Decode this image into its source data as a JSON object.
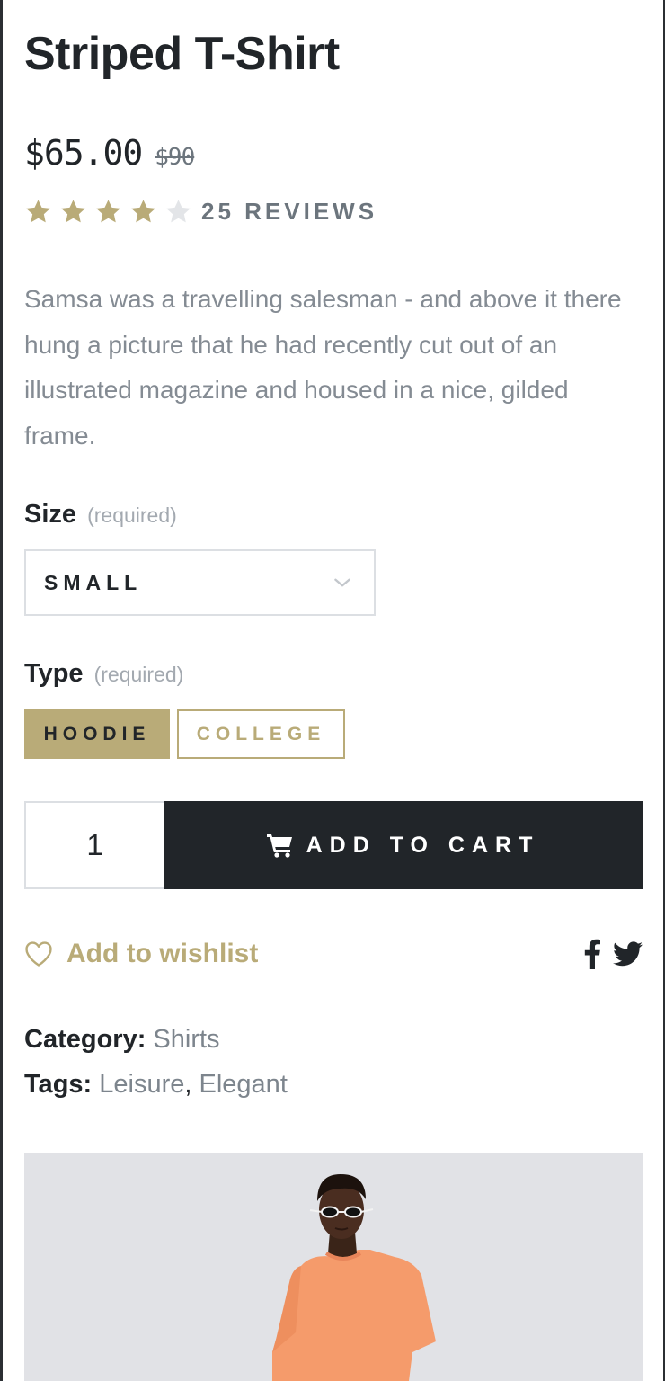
{
  "product": {
    "title": "Striped T-Shirt",
    "price": "$65.00",
    "old_price": "$90",
    "rating": 4,
    "rating_max": 5,
    "reviews_label": "25 REVIEWS",
    "description": "Samsa was a travelling salesman - and above it there hung a picture that he had recently cut out of an illustrated magazine and housed in a nice, gilded frame."
  },
  "size": {
    "label": "Size",
    "required": "(required)",
    "selected": "SMALL",
    "icon": "chevron-down-icon"
  },
  "type": {
    "label": "Type",
    "required": "(required)",
    "options": [
      {
        "label": "HOODIE",
        "active": true
      },
      {
        "label": "COLLEGE",
        "active": false
      }
    ]
  },
  "cart": {
    "quantity": "1",
    "add_label": "ADD TO CART",
    "icon": "cart-icon"
  },
  "wishlist": {
    "label": "Add to wishlist",
    "icon": "heart-icon"
  },
  "share": {
    "icons": [
      "facebook-icon",
      "twitter-icon"
    ]
  },
  "meta": {
    "category_key": "Category:",
    "category_value": "Shirts",
    "tags_key": "Tags:",
    "tags": [
      "Leisure",
      "Elegant"
    ],
    "tags_separator": ","
  },
  "colors": {
    "accent": "#b9ab78",
    "dark": "#212529",
    "muted": "#848b93",
    "star_empty": "#e3e5e8",
    "image_bg": "#e1e2e6"
  }
}
